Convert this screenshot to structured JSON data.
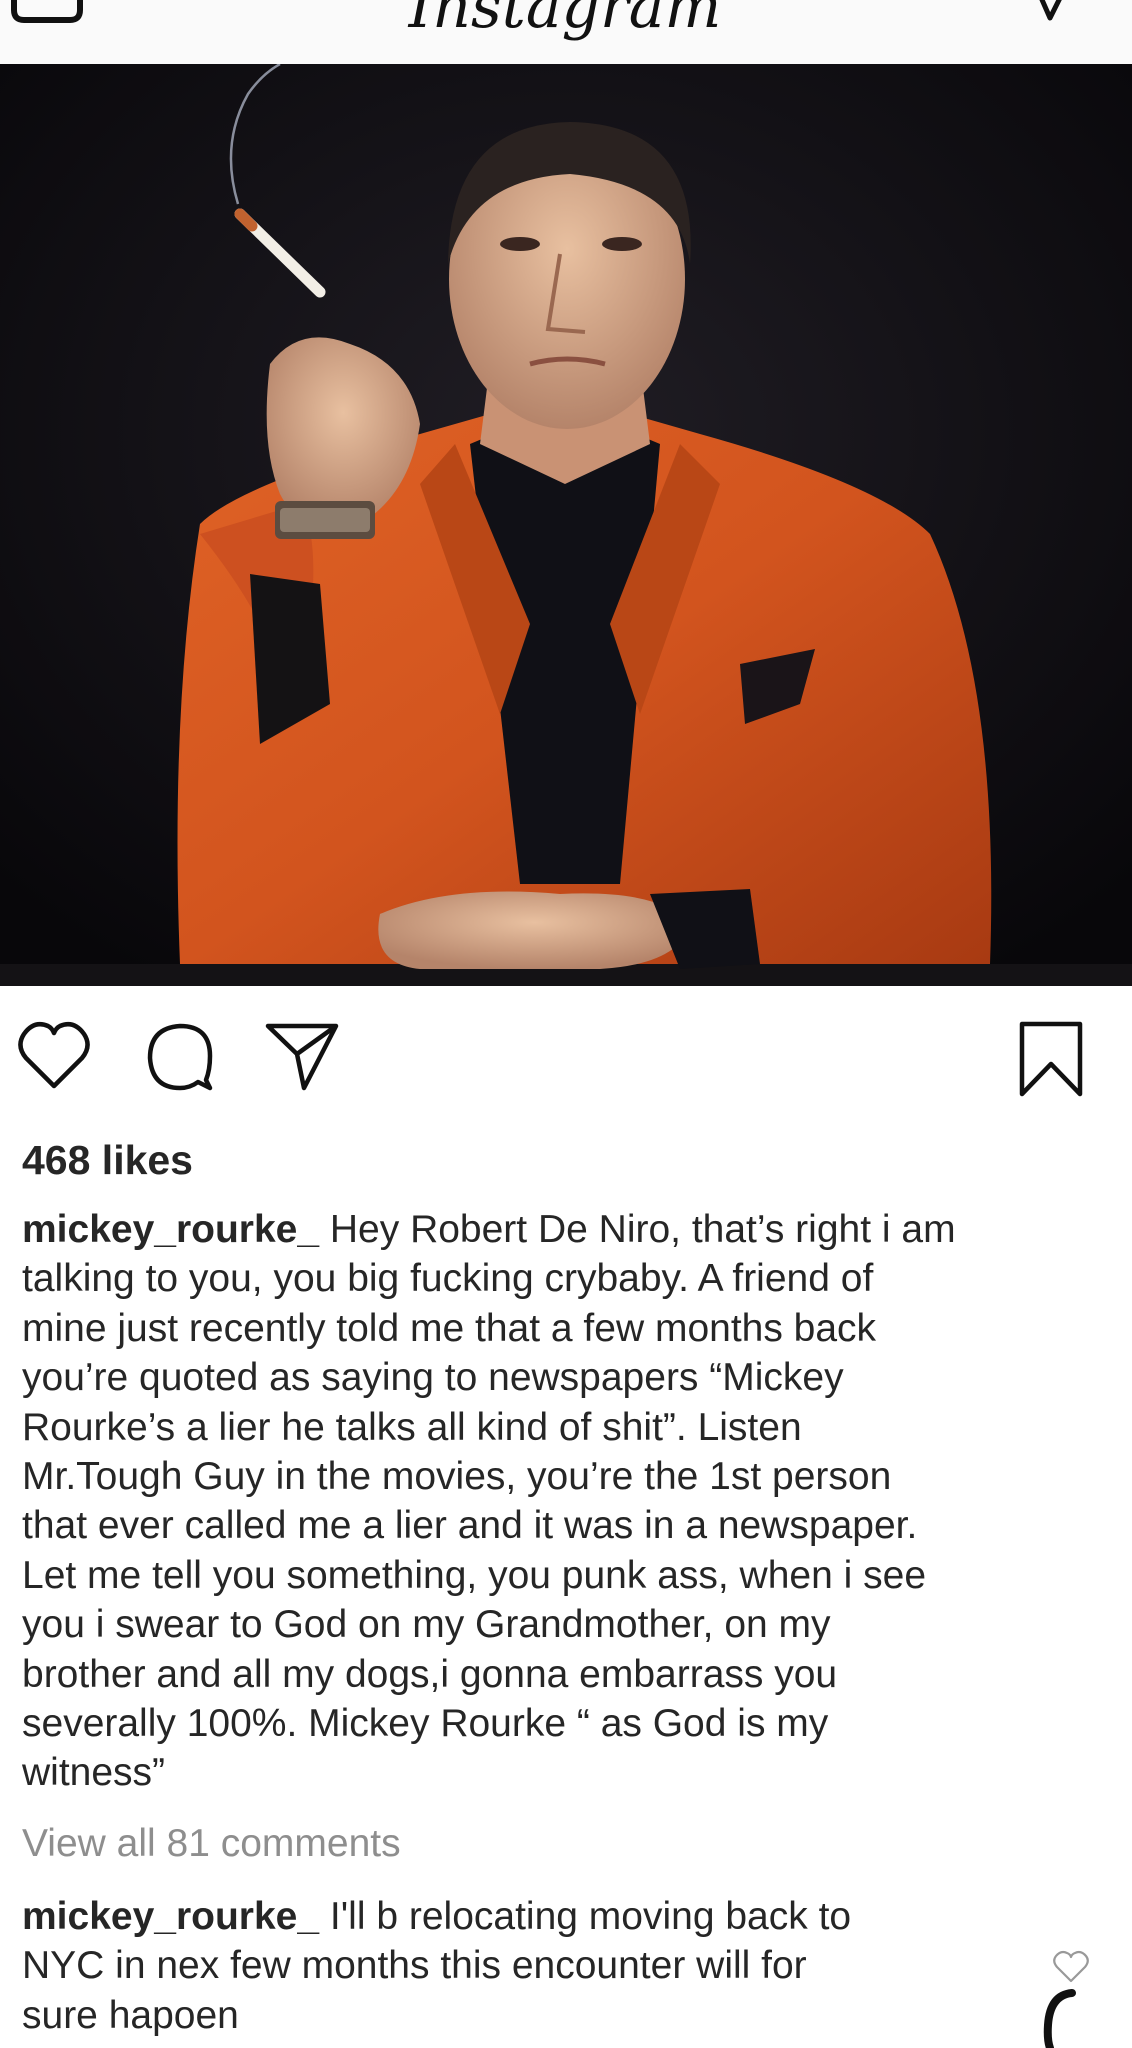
{
  "header": {
    "logo_text": "Instagram",
    "left_icon": "camera-icon",
    "right_icon": "direct-message-icon"
  },
  "post": {
    "image_description_icon": "photo",
    "actions": {
      "like_icon": "heart-icon",
      "comment_icon": "comment-bubble-icon",
      "share_icon": "paper-plane-icon",
      "save_icon": "bookmark-icon"
    },
    "likes": "468 likes",
    "caption": {
      "username": "mickey_rourke_",
      "text": " Hey Robert De Niro, that’s right i am\ntalking to you, you big fucking crybaby. A friend of\nmine just recently told me that a few months back\nyou’re quoted as saying to newspapers “Mickey\nRourke’s a lier he talks all kind of shit”. Listen\nMr.Tough Guy in the movies, you’re the 1st person\nthat ever called me a lier and it was in a newspaper.\nLet me tell you something, you punk ass, when i see\nyou  i swear to God on my Grandmother, on my\nbrother and all my dogs,i gonna embarrass you\nseverally 100%. Mickey Rourke “ as God is my\nwitness”"
    },
    "view_comments": "View all 81 comments",
    "comment": {
      "username": "mickey_rourke_",
      "text": " I'll b relocating  moving back to\nNYC in nex few months this encounter will for\nsure hapoen"
    }
  },
  "colors": {
    "text": "#262626",
    "muted": "#8e8e8e",
    "jacket": "#d2541e",
    "background": "#ffffff"
  }
}
